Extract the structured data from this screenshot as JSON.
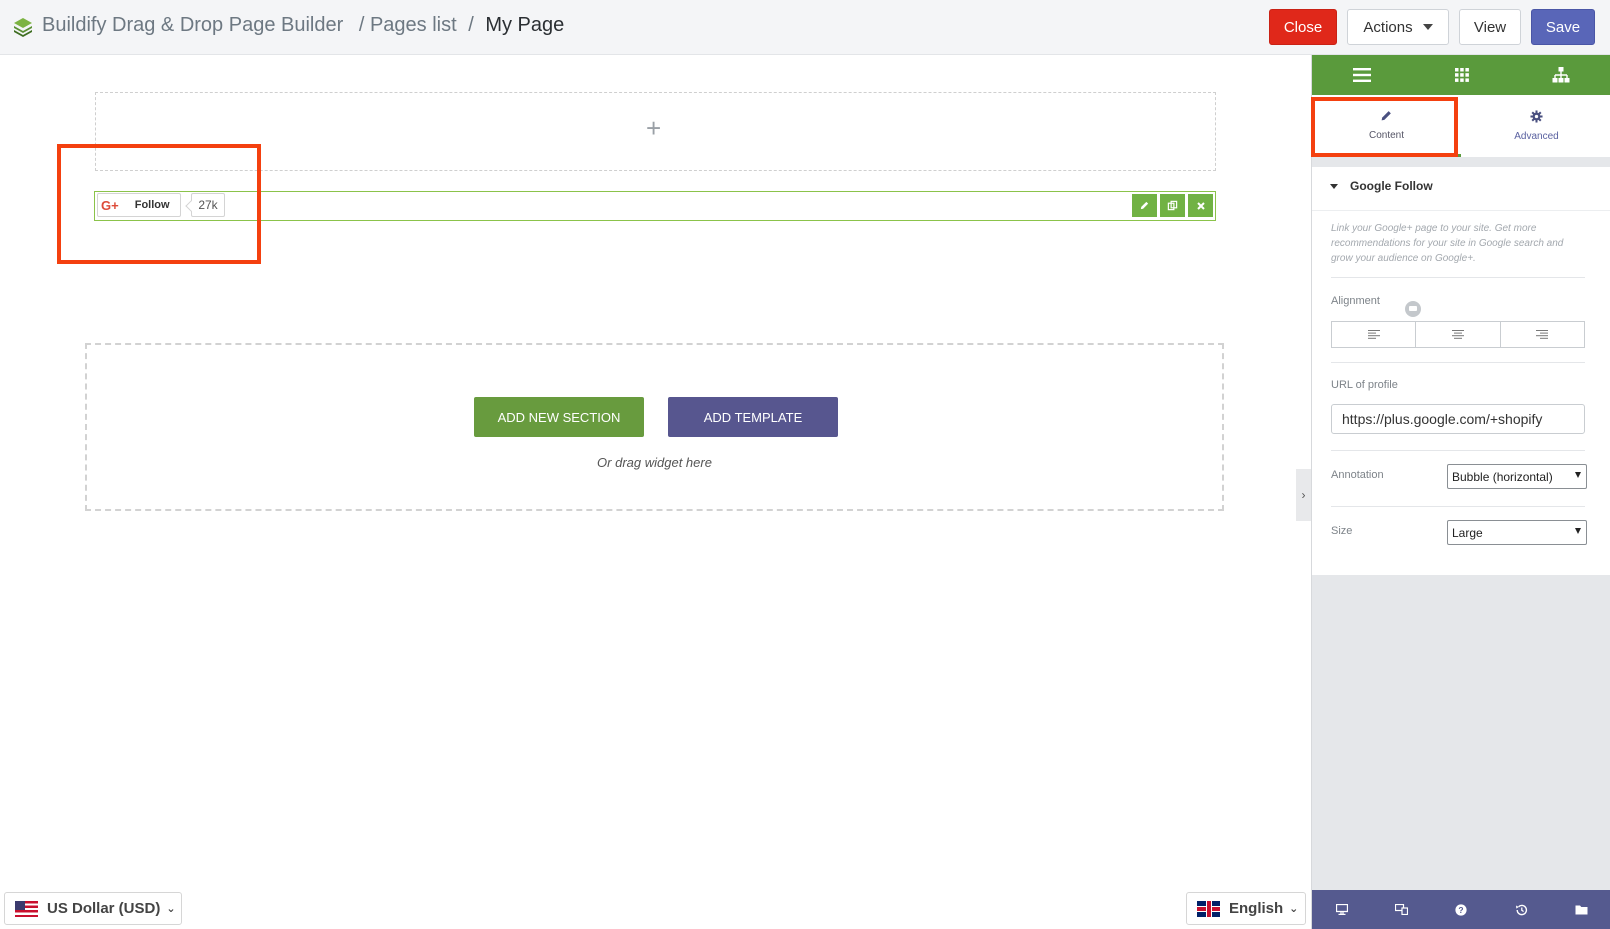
{
  "header": {
    "app_title": "Buildify Drag & Drop Page Builder",
    "crumb_pages": "/ Pages list",
    "crumb_sep": "/",
    "current_page": "My Page",
    "buttons": {
      "close": "Close",
      "actions": "Actions",
      "view": "View",
      "save": "Save"
    }
  },
  "canvas": {
    "empty_section_icon": "plus-icon",
    "widget": {
      "gplus_label": "G+",
      "follow_label": "Follow",
      "count": "27k",
      "tools": [
        "edit-icon",
        "duplicate-icon",
        "remove-icon"
      ]
    },
    "drop_zone": {
      "add_section": "ADD NEW SECTION",
      "add_template": "ADD TEMPLATE",
      "hint": "Or drag widget here"
    }
  },
  "footer": {
    "currency": "US Dollar (USD)",
    "language": "English"
  },
  "panel": {
    "top_tabs": [
      "menu-icon",
      "widgets-grid-icon",
      "navigator-icon"
    ],
    "tabs": {
      "content": "Content",
      "advanced": "Advanced"
    },
    "section_title": "Google Follow",
    "description": "Link your Google+ page to your site. Get more recommendations for your site in Google search and grow your audience on Google+.",
    "alignment_label": "Alignment",
    "url_label": "URL of profile",
    "url_value": "https://plus.google.com/+shopify",
    "annotation_label": "Annotation",
    "annotation_value": "Bubble (horizontal)",
    "size_label": "Size",
    "size_value": "Large",
    "footer_icons": [
      "desktop-icon",
      "responsive-icon",
      "help-icon",
      "history-icon",
      "folder-icon"
    ]
  },
  "colors": {
    "accent_green": "#5a9a3c",
    "close_red": "#e0281a",
    "save_blue": "#5966b8",
    "highlight": "#f4400f"
  }
}
